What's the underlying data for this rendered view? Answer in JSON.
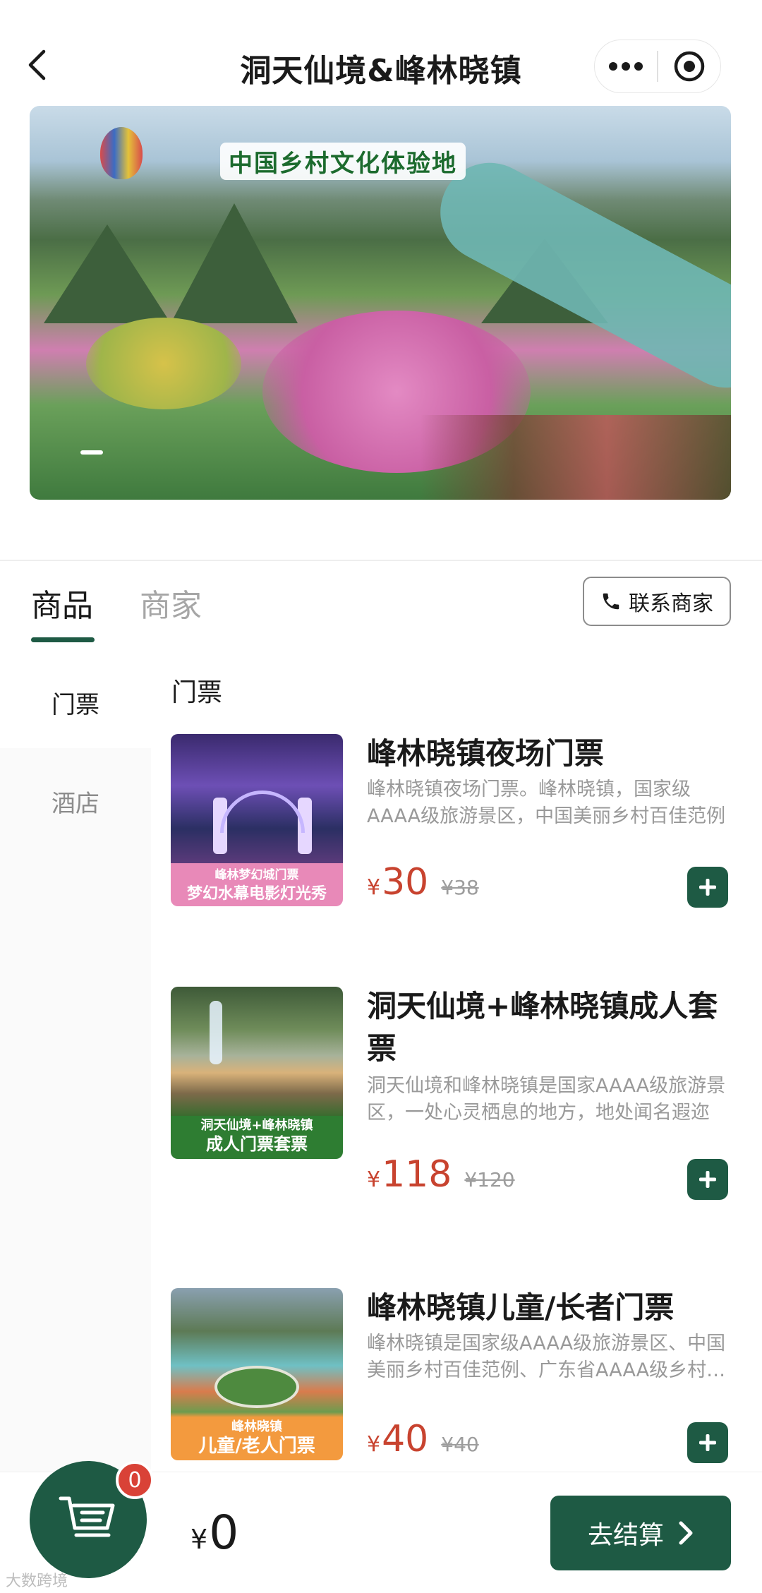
{
  "header": {
    "title": "洞天仙境&峰林晓镇",
    "back_icon": "chevron-left-icon",
    "more_icon": "more-dots-icon",
    "close_icon": "target-circle-icon"
  },
  "banner": {
    "subtitle": "中国乡村文化体验地"
  },
  "tabs": [
    {
      "label": "商品",
      "active": true
    },
    {
      "label": "商家",
      "active": false
    }
  ],
  "contact_button": {
    "label": "联系商家",
    "icon": "phone-icon"
  },
  "side_menu": [
    {
      "label": "门票",
      "active": true
    },
    {
      "label": "酒店",
      "active": false
    }
  ],
  "section_title": "门票",
  "products": [
    {
      "name": "峰林晓镇夜场门票",
      "description": "峰林晓镇夜场门票。峰林晓镇，国家级AAAA级旅游景区，中国美丽乡村百佳范例",
      "currency": "¥",
      "price": "30",
      "original_price": "¥38",
      "thumb_caption_top": "峰林梦幻城门票",
      "thumb_caption_bottom": "梦幻水幕电影灯光秀"
    },
    {
      "name": "洞天仙境+峰林晓镇成人套票",
      "description": "洞天仙境和峰林晓镇是国家AAAA级旅游景区，一处心灵栖息的地方，地处闻名遐迩",
      "currency": "¥",
      "price": "118",
      "original_price": "¥120",
      "thumb_caption_top": "洞天仙境+峰林晓镇",
      "thumb_caption_bottom": "成人门票套票"
    },
    {
      "name": "峰林晓镇儿童/长者门票",
      "description": "峰林晓镇是国家级AAAA级旅游景区、中国美丽乡村百佳范例、广东省AAAA级乡村旅游区",
      "currency": "¥",
      "price": "40",
      "original_price": "¥40",
      "thumb_caption_top": "峰林晓镇",
      "thumb_caption_bottom": "儿童/老人门票"
    }
  ],
  "cart": {
    "count": "0",
    "currency": "¥",
    "total": "0",
    "checkout_label": "去结算",
    "icon": "cart-icon"
  },
  "watermark": "大数跨境",
  "colors": {
    "primary": "#1e5a44",
    "price": "#c8432f",
    "badge": "#d94237"
  }
}
